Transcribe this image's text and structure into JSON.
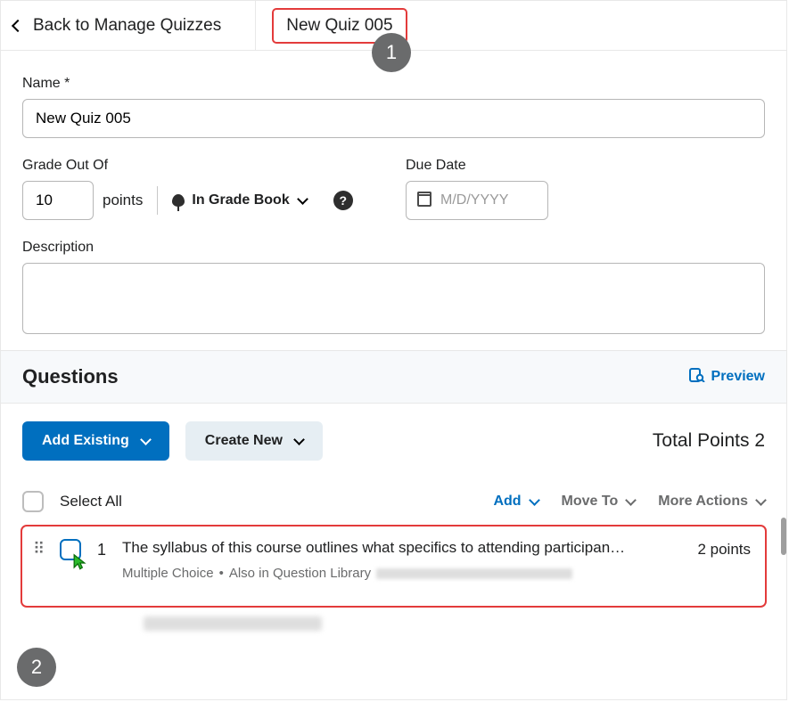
{
  "header": {
    "back_label": "Back to Manage Quizzes",
    "title": "New Quiz 005"
  },
  "form": {
    "name_label": "Name *",
    "name_value": "New Quiz 005",
    "grade_label": "Grade Out Of",
    "grade_value": "10",
    "points_suffix": "points",
    "gradebook_label": "In Grade Book",
    "due_label": "Due Date",
    "due_placeholder": "M/D/YYYY",
    "desc_label": "Description"
  },
  "questions": {
    "heading": "Questions",
    "preview_label": "Preview",
    "add_existing_label": "Add Existing",
    "create_new_label": "Create New",
    "total_points_label": "Total Points 2",
    "select_all_label": "Select All",
    "menu": {
      "add": "Add",
      "move_to": "Move To",
      "more": "More Actions"
    },
    "item": {
      "number": "1",
      "title": "The syllabus of this course outlines what specifics to attending participan…",
      "type": "Multiple Choice",
      "also_in": "Also in Question Library",
      "points": "2 points"
    }
  },
  "callouts": {
    "one": "1",
    "two": "2"
  }
}
